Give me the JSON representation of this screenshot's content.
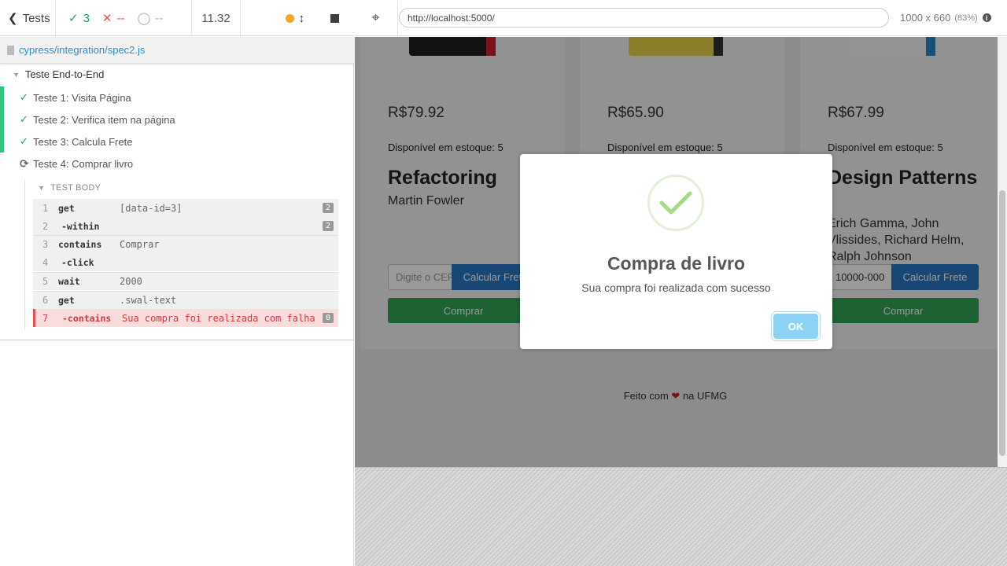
{
  "reporter": {
    "tests_button": "Tests",
    "stats": {
      "passed": "3",
      "failed": "--",
      "pending": "--"
    },
    "duration": "11.32",
    "spec_path": "cypress/integration/spec2.js",
    "suite_title": "Teste End-to-End",
    "tests": [
      {
        "label": "Teste 1: Visita Página",
        "state": "passed"
      },
      {
        "label": "Teste 2: Verifica item na página",
        "state": "passed"
      },
      {
        "label": "Teste 3: Calcula Frete",
        "state": "passed"
      },
      {
        "label": "Teste 4: Comprar livro",
        "state": "running"
      }
    ],
    "test_body_title": "TEST BODY",
    "commands": [
      {
        "num": "1",
        "name": "get",
        "arg": "[data-id=3]",
        "badge": "2"
      },
      {
        "num": "2",
        "name": "-within",
        "arg": "",
        "badge": "2"
      },
      {
        "num": "3",
        "name": "contains",
        "arg": "Comprar",
        "badge": ""
      },
      {
        "num": "4",
        "name": "-click",
        "arg": "",
        "badge": ""
      },
      {
        "num": "5",
        "name": "wait",
        "arg": "2000",
        "badge": ""
      },
      {
        "num": "6",
        "name": "get",
        "arg": ".swal-text",
        "badge": ""
      },
      {
        "num": "7",
        "name": "-contains",
        "arg": "Sua compra foi realizada com falha",
        "badge": "0",
        "state": "failed"
      }
    ]
  },
  "runner": {
    "url": "http://localhost:5000/",
    "viewport": "1000 x 660",
    "scale": "(83%)"
  },
  "page": {
    "cards": [
      {
        "price": "R$79.92",
        "stock": "Disponível em estoque: 5",
        "title": "Refactoring",
        "author": "Martin Fowler",
        "cep_placeholder": "Digite o CEP",
        "frete_label": "Calcular Frete",
        "buy_label": "Comprar"
      },
      {
        "price": "R$65.90",
        "stock": "Disponível em estoque: 5",
        "title": "",
        "author": "",
        "cep_placeholder": "",
        "frete_label": "",
        "buy_label": ""
      },
      {
        "price": "R$67.99",
        "stock": "Disponível em estoque: 5",
        "title": "Design Patterns",
        "author": "Erich Gamma, John Vlissides, Richard Helm, Ralph Johnson",
        "cep_value": "10000-000",
        "frete_label": "Calcular Frete",
        "buy_label": "Comprar"
      }
    ],
    "footer": {
      "before": "Feito com",
      "after": "na UFMG"
    }
  },
  "modal": {
    "title": "Compra de livro",
    "text": "Sua compra foi realizada com sucesso",
    "ok_label": "OK"
  },
  "colors": {
    "passed": "#2a9a6a",
    "failed": "#e94f4f",
    "frete_button": "#2a77c4",
    "buy_button": "#32a256",
    "ok_button": "#8cd4f5"
  }
}
